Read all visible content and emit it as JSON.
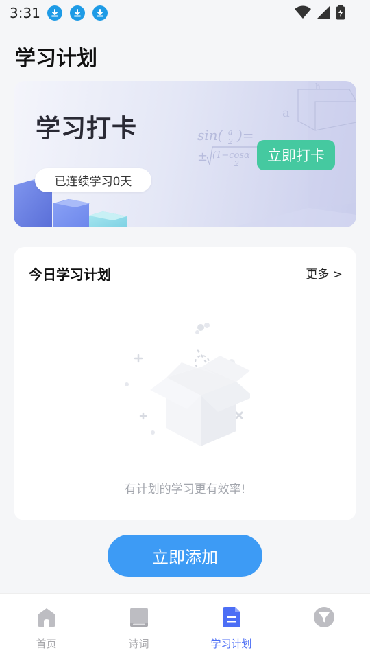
{
  "status_bar": {
    "time": "3:31"
  },
  "page": {
    "title": "学习计划"
  },
  "banner": {
    "title": "学习打卡",
    "streak_text": "已连续学习0天",
    "checkin_label": "立即打卡"
  },
  "plan_card": {
    "title": "今日学习计划",
    "more_label": "更多 >",
    "empty_text": "有计划的学习更有效率!"
  },
  "add_button": {
    "label": "立即添加"
  },
  "tabs": [
    {
      "label": "首页",
      "icon": "home-icon",
      "active": false
    },
    {
      "label": "诗词",
      "icon": "book-icon",
      "active": false
    },
    {
      "label": "学习计划",
      "icon": "document-icon",
      "active": true
    },
    {
      "label": "",
      "icon": "funnel-icon",
      "active": false
    }
  ],
  "colors": {
    "accent": "#4c6ef5",
    "checkin": "#45c9a0",
    "add_button": "#3d9bf5"
  }
}
